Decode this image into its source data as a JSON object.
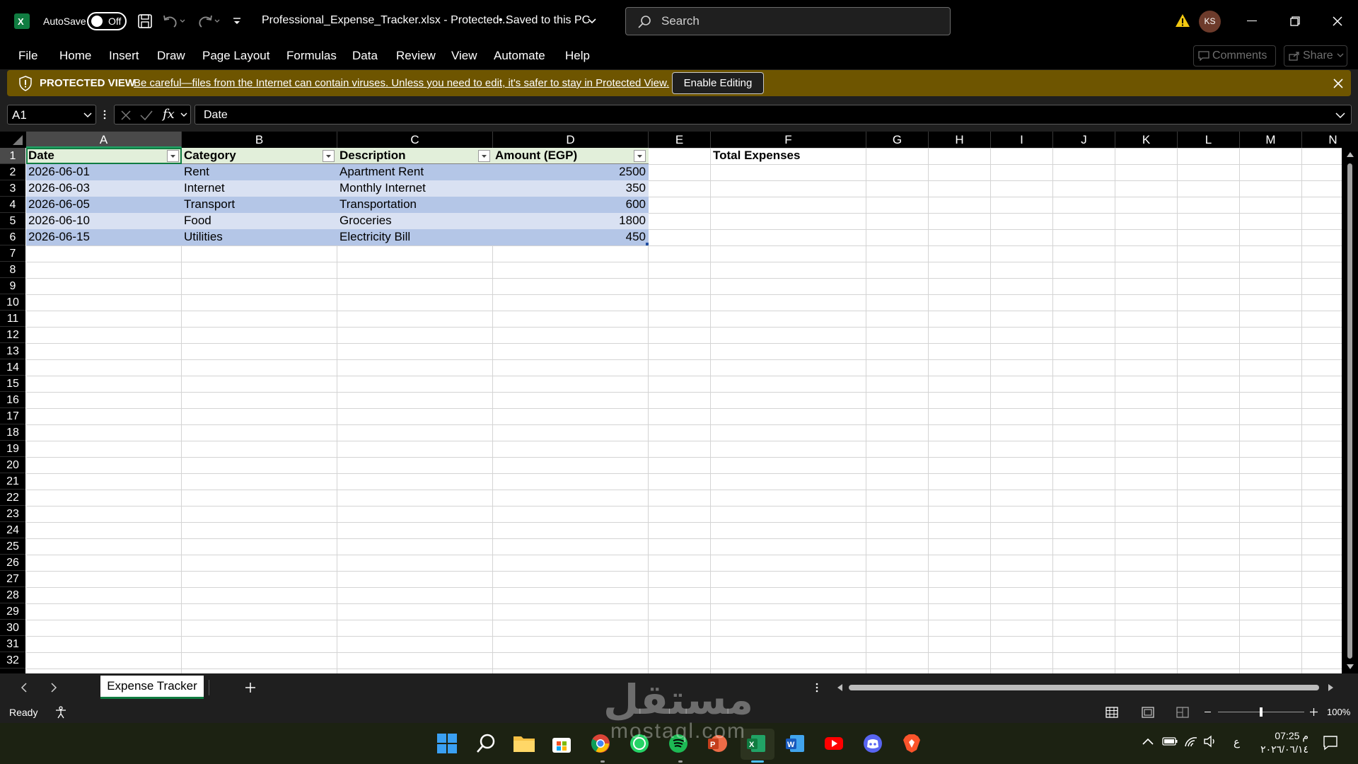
{
  "titlebar": {
    "autosave_label": "AutoSave",
    "autosave_state": "Off",
    "filename": "Professional_Expense_Tracker.xlsx  -  Protected...",
    "save_status": "• Saved to this PC",
    "search_placeholder": "Search",
    "user_initials": "KS"
  },
  "menu": {
    "items": [
      "File",
      "Home",
      "Insert",
      "Draw",
      "Page Layout",
      "Formulas",
      "Data",
      "Review",
      "View",
      "Automate",
      "Help"
    ],
    "comments": "Comments",
    "share": "Share"
  },
  "protected_view": {
    "title": "PROTECTED VIEW",
    "message": "Be careful—files from the Internet can contain viruses. Unless you need to edit, it's safer to stay in Protected View.",
    "button": "Enable Editing"
  },
  "formula_bar": {
    "name_box": "A1",
    "fx": "fx",
    "content": "Date"
  },
  "grid": {
    "columns": [
      "A",
      "B",
      "C",
      "D",
      "E",
      "F",
      "G",
      "H",
      "I",
      "J",
      "K",
      "L",
      "M",
      "N"
    ],
    "selected_column": "A",
    "selected_row": 1,
    "row_count": 32,
    "table": {
      "headers": [
        "Date",
        "Category",
        "Description",
        "Amount (EGP)"
      ],
      "rows": [
        [
          "2026-06-01",
          "Rent",
          "Apartment Rent",
          "2500"
        ],
        [
          "2026-06-03",
          "Internet",
          "Monthly Internet",
          "350"
        ],
        [
          "2026-06-05",
          "Transport",
          "Transportation",
          "600"
        ],
        [
          "2026-06-10",
          "Food",
          "Groceries",
          "1800"
        ],
        [
          "2026-06-15",
          "Utilities",
          "Electricity Bill",
          "450"
        ]
      ]
    },
    "f1_label": "Total Expenses",
    "colors": {
      "band_dark": "#b4c6e7",
      "band_light": "#d9e1f2",
      "header_fill": "#e2efda",
      "accent": "#107c41"
    }
  },
  "sheets": {
    "active": "Expense Tracker"
  },
  "status": {
    "ready": "Ready",
    "zoom": "100%"
  },
  "taskbar": {
    "apps": [
      "windows-start",
      "search",
      "file-explorer",
      "microsoft-store",
      "chrome",
      "whatsapp",
      "spotify",
      "powerpoint",
      "excel",
      "word",
      "youtube",
      "discord",
      "brave"
    ],
    "time": "07:25 م",
    "date": "٢٠٢٦/٠٦/١٤",
    "lang": "ع"
  },
  "watermark": {
    "arabic": "مستقل",
    "latin": "mostaql.com"
  }
}
